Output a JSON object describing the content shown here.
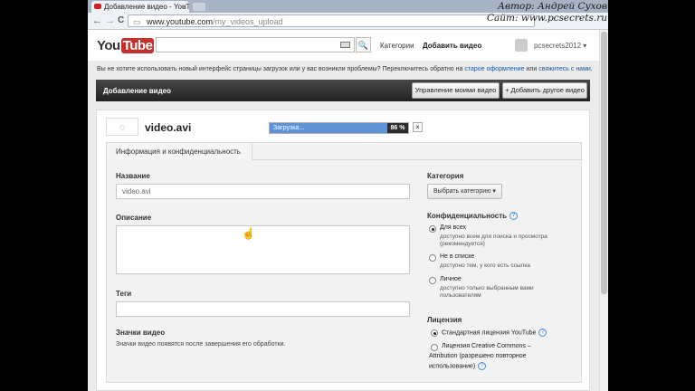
{
  "browser": {
    "tab_title": "Добавление видео - YouT",
    "tab_close": "×",
    "url_host": "www.youtube.com",
    "url_path": "/my_videos_upload",
    "back": "←",
    "forward": "→",
    "reload": "C"
  },
  "watermark": {
    "line1": "Автор: Андрей Сухов",
    "line2": "Сайт: www.pcsecrets.ru"
  },
  "header": {
    "logo_text": "You",
    "logo_tube": "Tube",
    "search_icon": "🔍",
    "link_categories": "Категории",
    "link_upload": "Добавить видео",
    "username": "pcsecrets2012",
    "user_dropdown": "▾"
  },
  "notice": {
    "text": "Вы не хотите использовать новый интерфейс страницы загрузок или у вас возникли проблемы? Переключитесь обратно на",
    "link_old": "старое оформление",
    "or": "или",
    "link_contact": "свяжитесь с нами",
    "end": "."
  },
  "upload_bar": {
    "title": "Добавление видео",
    "manage_btn": "Управление моими видео",
    "add_btn": "+ Добавить другое видео"
  },
  "file": {
    "name": "video.avi",
    "status": "Загрузка...",
    "percent_label": "86 %",
    "progress": 0.86,
    "close": "×",
    "spinner": "◌"
  },
  "form": {
    "tab_info": "Информация и конфиденциальность",
    "title_label": "Название",
    "title_value": "video.avi",
    "desc_label": "Описание",
    "tags_label": "Теги",
    "thumbs_label": "Значки видео",
    "thumbs_note": "Значки видео появятся после завершения его обработки.",
    "category_label": "Категория",
    "category_btn": "Выбрать категорию ▾",
    "privacy_label": "Конфиденциальность",
    "privacy_options": [
      {
        "label": "Для всех",
        "desc1": "доступно всем для поиска и просмотра",
        "desc2": "(рекомендуется)",
        "selected": true
      },
      {
        "label": "Не в списке",
        "desc1": "доступно тем, у кого есть ссылка",
        "desc2": "",
        "selected": false
      },
      {
        "label": "Личное",
        "desc1": "доступно только выбранным вами",
        "desc2": "пользователям",
        "selected": false
      }
    ],
    "license_label": "Лицензия",
    "license_options": [
      {
        "label": "Стандартная лицензия YouTube",
        "selected": true
      },
      {
        "label": "Лицензия Creative Commons –",
        "selected": false
      }
    ],
    "license_cc_line2": "Attribution (разрешено повторное",
    "license_cc_line3": "использование)",
    "help_glyph": "?"
  },
  "colors": {
    "progress_fill": "#5e93d6",
    "link": "#1b58a0",
    "logo_red": "#c4302b"
  }
}
